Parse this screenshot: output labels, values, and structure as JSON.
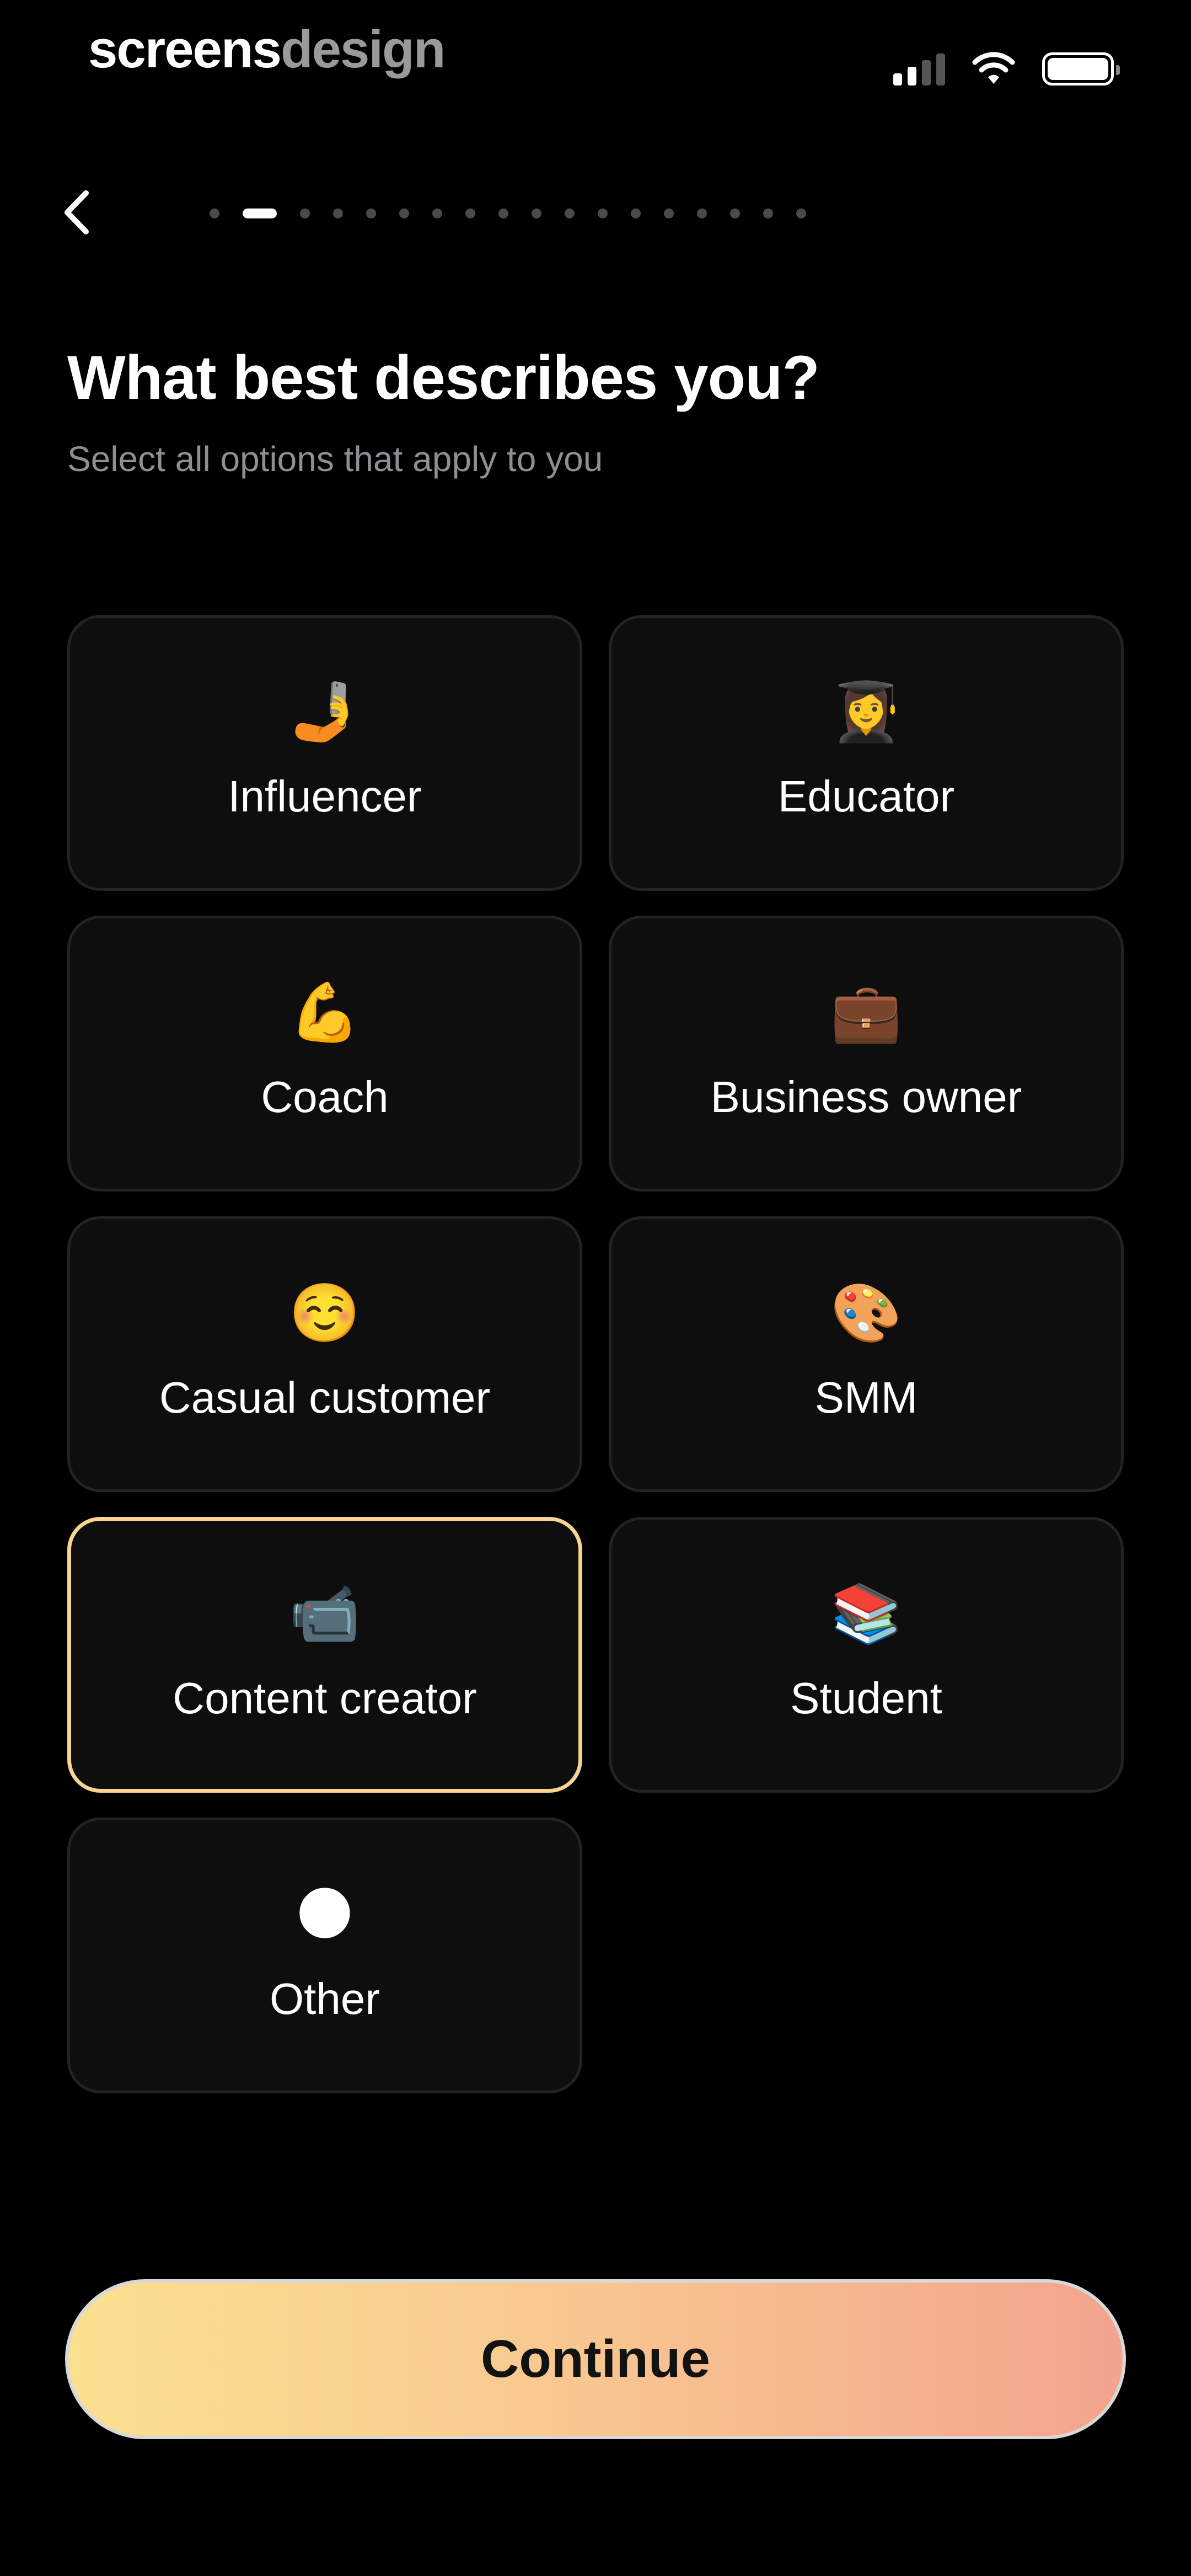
{
  "status_bar": {
    "brand_part1": "screens",
    "brand_part2": "design",
    "icons": [
      "signal-icon",
      "wifi-icon",
      "battery-icon"
    ]
  },
  "nav": {
    "back_icon": "chevron-left-icon",
    "progress": {
      "total_steps": 18,
      "current_step": 2
    }
  },
  "header": {
    "title": "What best describes you?",
    "subtitle": "Select all options that apply to you"
  },
  "options": [
    {
      "id": "influencer",
      "label": "Influencer",
      "emoji": "🤳",
      "selected": false
    },
    {
      "id": "educator",
      "label": "Educator",
      "emoji": "👩‍🎓",
      "selected": false
    },
    {
      "id": "coach",
      "label": "Coach",
      "emoji": "💪",
      "selected": false
    },
    {
      "id": "business-owner",
      "label": "Business owner",
      "emoji": "💼",
      "selected": false
    },
    {
      "id": "casual-customer",
      "label": "Casual customer",
      "emoji": "☺️",
      "selected": false
    },
    {
      "id": "smm",
      "label": "SMM",
      "emoji": "🎨",
      "selected": false
    },
    {
      "id": "content-creator",
      "label": "Content creator",
      "emoji": "📹",
      "selected": true
    },
    {
      "id": "student",
      "label": "Student",
      "emoji": "📚",
      "selected": false
    },
    {
      "id": "other",
      "label": "Other",
      "emoji": "🌑",
      "selected": false
    }
  ],
  "footer": {
    "continue_label": "Continue"
  },
  "colors": {
    "background": "#000000",
    "card": "#0e0e0f",
    "card_border": "#232325",
    "selected_border": "#f6d493",
    "button_gradient_start": "#fbe08f",
    "button_gradient_end": "#f3a38e",
    "subtitle": "#8e8e93"
  }
}
